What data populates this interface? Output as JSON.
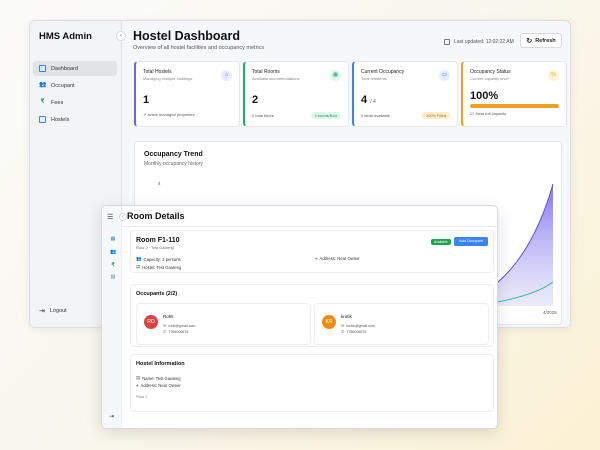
{
  "dashboard": {
    "brand": "HMS Admin",
    "nav": [
      {
        "label": "Dashboard",
        "icon": "dashboard-icon",
        "active": true
      },
      {
        "label": "Occupant",
        "icon": "users-icon",
        "active": false
      },
      {
        "label": "Fees",
        "icon": "rupee-icon",
        "active": false
      },
      {
        "label": "Hostels",
        "icon": "building-icon",
        "active": false
      }
    ],
    "logout": "Logout",
    "title": "Hostel Dashboard",
    "subtitle": "Overview of all hostel facilities and occupancy metrics",
    "last_updated": "Last updated: 12:02:22 AM",
    "refresh_label": "Refresh",
    "cards": [
      {
        "title": "Total Hostels",
        "sub": "Managing multiple buildings",
        "value": "1",
        "value_suffix": "",
        "foot": "↗ active managed properties",
        "pill": "",
        "accent": "#5b6cf0",
        "icon_bg": "#e8eaff"
      },
      {
        "title": "Total Rooms",
        "sub": "Available accommodations",
        "value": "2",
        "value_suffix": "",
        "foot": "2 total floors",
        "pill": "1 rooms/floor",
        "accent": "#1fae6a",
        "icon_bg": "#e2f6ea"
      },
      {
        "title": "Current Occupancy",
        "sub": "Total residents",
        "value": "4",
        "value_suffix": "/ 4",
        "foot": "0 beds available",
        "pill": "100% Filled",
        "accent": "#3b82f6",
        "icon_bg": "#e4eefe"
      },
      {
        "title": "Occupancy Status",
        "sub": "Current capacity level",
        "value": "100%",
        "value_suffix": "",
        "foot": "Near full capacity",
        "pill": "",
        "accent": "#f0a020",
        "icon_bg": "#fdf1d6"
      }
    ],
    "occupancy_progress": 1.0,
    "trend": {
      "title": "Occupancy Trend",
      "subtitle": "Monthly occupancy history",
      "y_tick": "4",
      "x_tick": "4/2025"
    }
  },
  "room_details": {
    "page_title": "Room Details",
    "room": {
      "title": "Room F1-110",
      "sub": "Floor 2 · Test Gauteng",
      "status_badge": "Available",
      "add_button": "Add Occupant",
      "capacity": "Capacity: 2 persons",
      "hostel": "Hostel: Test Gauteng",
      "address": "Address: Near Owner"
    },
    "occupants_title": "Occupants (2/2)",
    "occupants": [
      {
        "initials": "RO",
        "name": "Rohit",
        "email": "rohit@gmail.com",
        "phone": "7766006876",
        "color": "#d94343"
      },
      {
        "initials": "KR",
        "name": "krutik",
        "email": "krutik@gmail.com",
        "phone": "7766006876",
        "color": "#f08a12"
      }
    ],
    "hostel_info": {
      "title": "Hostel Information",
      "name": "Name: Test Gauteng",
      "address": "Address: Near Owner",
      "floor": "Floor 2"
    }
  }
}
